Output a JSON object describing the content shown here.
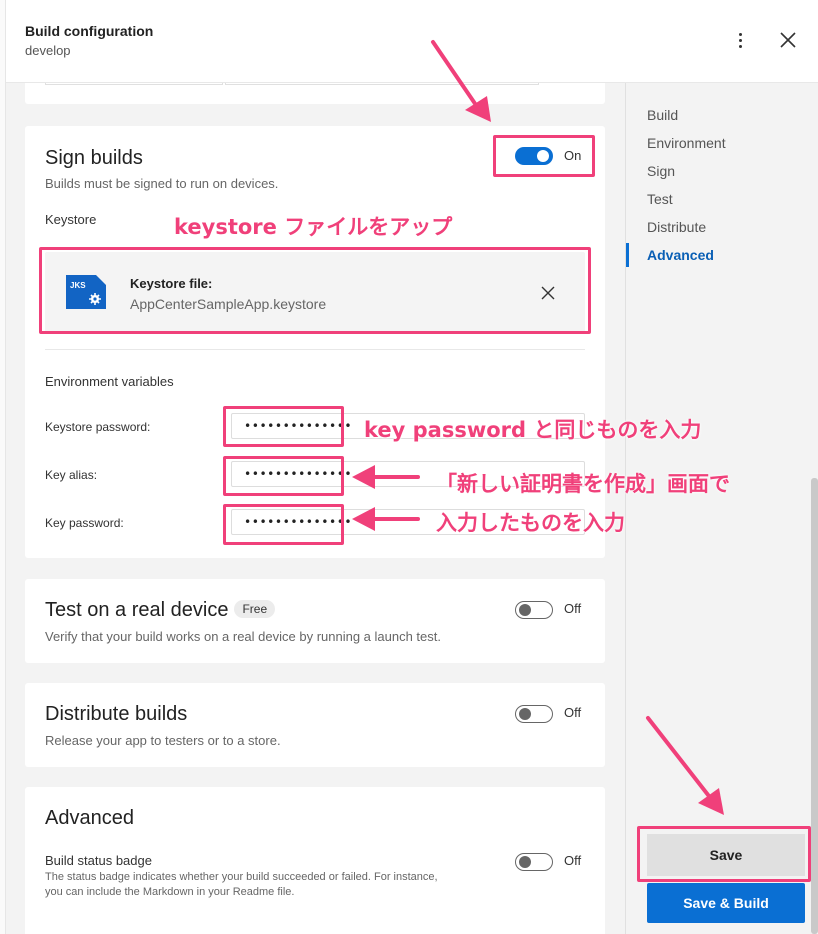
{
  "header": {
    "title": "Build configuration",
    "branch": "develop"
  },
  "sign_builds": {
    "title": "Sign builds",
    "description": "Builds must be signed to run on devices.",
    "toggle_label": "On",
    "keystore_label": "Keystore",
    "keystore_file_title": "Keystore file:",
    "keystore_file_name": "AppCenterSampleApp.keystore",
    "keystore_icon_text": "JKS",
    "env_vars_label": "Environment variables",
    "fields": [
      {
        "label": "Keystore password:",
        "value": "••••••••••••••"
      },
      {
        "label": "Key alias:",
        "value": "••••••••••••••"
      },
      {
        "label": "Key password:",
        "value": "••••••••••••••"
      }
    ]
  },
  "test_device": {
    "title": "Test on a real device",
    "badge": "Free",
    "description": "Verify that your build works on a real device by running a launch test.",
    "toggle_label": "Off"
  },
  "distribute": {
    "title": "Distribute builds",
    "description": "Release your app to testers or to a store.",
    "toggle_label": "Off"
  },
  "advanced": {
    "title": "Advanced",
    "badge_title": "Build status badge",
    "badge_description_1": "The status badge indicates whether your build succeeded or failed. For instance,",
    "badge_description_2": "you can include the Markdown in your Readme file.",
    "toggle_label": "Off"
  },
  "sidenav": {
    "items": [
      "Build",
      "Environment",
      "Sign",
      "Test",
      "Distribute",
      "Advanced"
    ],
    "active": "Advanced"
  },
  "buttons": {
    "save": "Save",
    "save_build": "Save & Build"
  },
  "annotations": {
    "upload_keystore": "keystore ファイルをアップ",
    "key_password_same": "key password と同じものを入力",
    "new_cert_line1": "「新しい証明書を作成」画面で",
    "new_cert_line2": "入力したものを入力"
  },
  "colors": {
    "accent": "#0a6fd3",
    "annotation": "#f0407a"
  }
}
